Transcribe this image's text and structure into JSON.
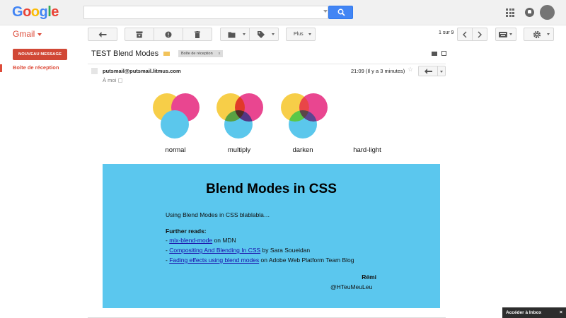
{
  "header": {
    "logo": {
      "letters": [
        "G",
        "o",
        "o",
        "g",
        "l",
        "e"
      ],
      "colors": [
        "#4285f4",
        "#ea4335",
        "#fbbc05",
        "#4285f4",
        "#34a853",
        "#ea4335"
      ]
    },
    "search": {
      "value": "",
      "placeholder": ""
    },
    "icons": [
      "search-icon",
      "apps-icon",
      "notifications-icon",
      "avatar"
    ]
  },
  "toolbar": {
    "gmail_label": "Gmail",
    "more_label": "Plus",
    "pager": "1 sur 9",
    "icons": [
      "back-icon",
      "archive-icon",
      "report-spam-icon",
      "delete-icon",
      "move-to-icon",
      "labels-icon",
      "older-icon",
      "newer-icon",
      "keyboard-icon",
      "settings-icon"
    ]
  },
  "sidebar": {
    "compose_label": "NOUVEAU MESSAGE",
    "items": [
      {
        "label": "Boîte de réception"
      }
    ]
  },
  "message": {
    "subject": "TEST Blend Modes",
    "inbox_chip": "Boîte de réception",
    "inbox_chip_close": "x",
    "sender": "putsmail@putsmail.litmus.com",
    "to": "À moi",
    "timestamp": "21:09 (Il y a 3 minutes)",
    "star": "☆"
  },
  "blend_demo": {
    "labels": [
      "normal",
      "multiply",
      "darken",
      "hard-light"
    ],
    "colors": {
      "yellow": "#f7ce48",
      "magenta": "#e94690",
      "blue": "#5bc7ec"
    }
  },
  "email_body": {
    "background": "#5bc7ee",
    "title": "Blend Modes in CSS",
    "intro": "Using Blend Modes in CSS blablabla…",
    "reads_title": "Further reads:",
    "reads": [
      {
        "prefix": "- ",
        "link": "mix-blend-mode",
        "suffix": " on MDN"
      },
      {
        "prefix": "- ",
        "link": "Compositing And Blending In CSS",
        "suffix": " by Sara Soueidan"
      },
      {
        "prefix": "- ",
        "link": "Fading effects using blend modes",
        "suffix": " on Adobe Web Platform Team Blog"
      }
    ],
    "signature_name": "Rémi",
    "signature_handle": "@HTeuMeuLeu"
  },
  "footer": {
    "inbox_promo": "Accéder à Inbox",
    "inbox_promo_close": "×"
  }
}
